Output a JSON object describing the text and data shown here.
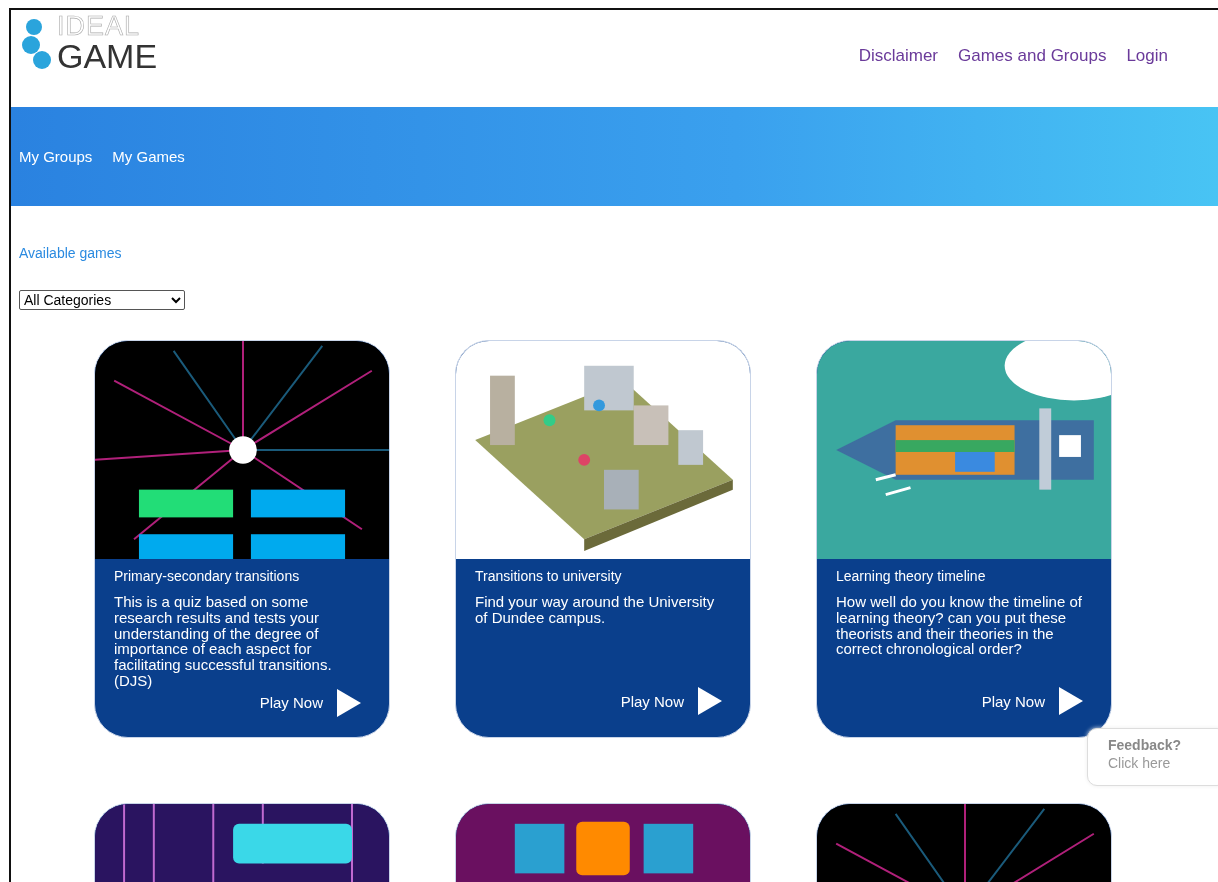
{
  "header": {
    "logo": {
      "top": "IDEAL",
      "bottom": "GAME"
    },
    "nav": [
      "Disclaimer",
      "Games and Groups",
      "Login"
    ]
  },
  "banner": {
    "links": [
      "My Groups",
      "My Games"
    ]
  },
  "content": {
    "heading_link": "Available games",
    "category_select": {
      "value": "All Categories"
    },
    "games": [
      {
        "kind": "quiz",
        "title": "Primary-secondary transitions",
        "description": "This is a quiz based on some research results and tests your understanding of the degree of importance of each aspect for facilitating successful transitions. (DJS)",
        "action": "Play Now"
      },
      {
        "kind": "campus",
        "title": "Transitions to university",
        "description": "Find your way around the University of Dundee campus.",
        "action": "Play Now"
      },
      {
        "kind": "ship",
        "title": "Learning theory timeline",
        "description": "How well do you know the timeline of learning theory? can you put these theorists and their theories in the correct chronological order?",
        "action": "Play Now"
      },
      {
        "kind": "swift"
      },
      {
        "kind": "tiles"
      },
      {
        "kind": "quiz"
      }
    ]
  },
  "feedback": {
    "title": "Feedback?",
    "link": "Click here"
  }
}
